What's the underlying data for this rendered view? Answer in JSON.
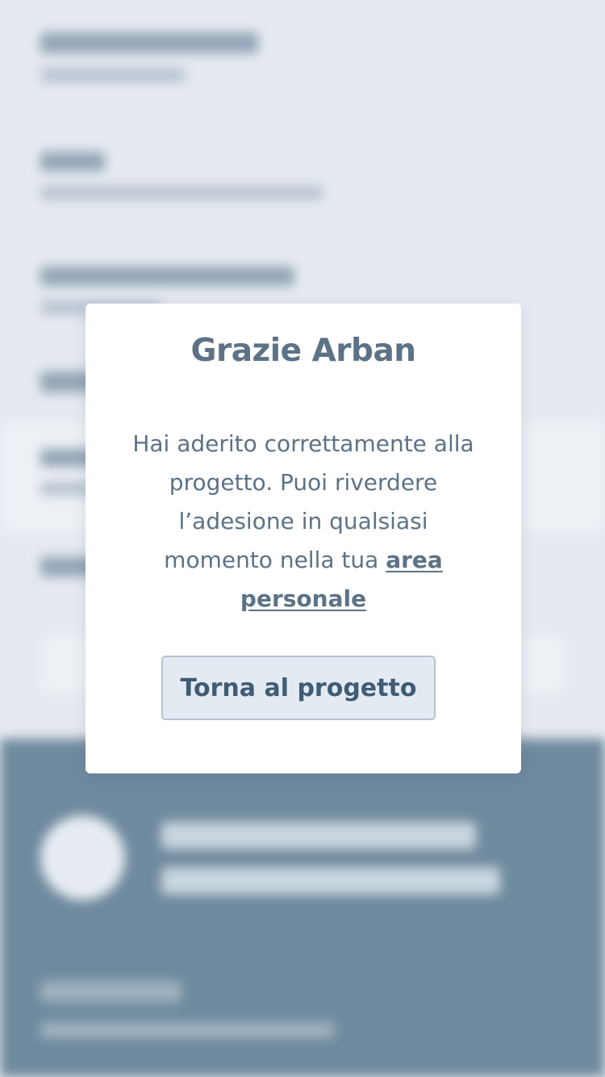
{
  "modal": {
    "title": "Grazie Arban",
    "message_text": "Hai aderito correttamente alla progetto. Puoi riverdere l’adesione in qualsiasi momento nella tua ",
    "link_label": "area personale",
    "button_label": "Torna al progetto"
  },
  "colors": {
    "modal_text": "#5c7286",
    "button_background": "#e4eaf1",
    "button_border": "#b2c3d3",
    "footer_background": "#6f8a9e"
  }
}
